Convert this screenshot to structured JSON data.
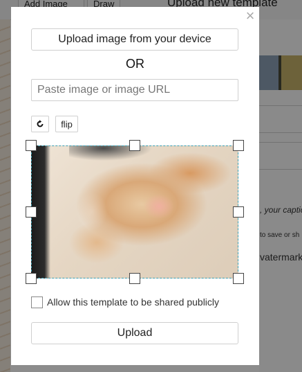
{
  "background": {
    "toolbar_buttons": [
      "Add Image",
      "Draw"
    ],
    "panel_title": "Upload new template",
    "side_texts": [
      ", your captio",
      "to save or sh",
      "vatermark"
    ]
  },
  "modal": {
    "close_label": "×",
    "upload_device_label": "Upload image from your device",
    "or_label": "OR",
    "url_input": {
      "placeholder": "Paste image or image URL",
      "value": ""
    },
    "rotate_icon": "rotate-icon",
    "flip_label": "flip",
    "crop_image": "cat-photo",
    "share_checkbox": {
      "label": "Allow this template to be shared publicly",
      "checked": false
    },
    "upload_label": "Upload"
  }
}
